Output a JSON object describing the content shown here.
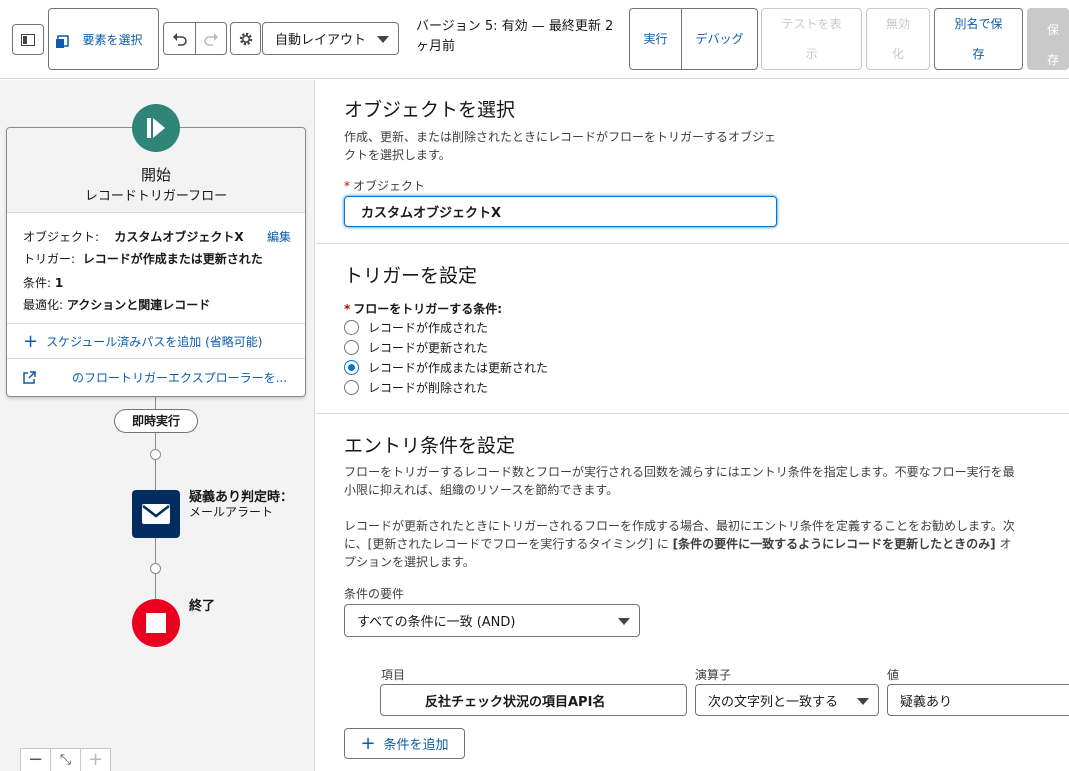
{
  "toolbar": {
    "select_element": "要素を選択",
    "layout_select": "自動レイアウト",
    "version_text": "バージョン 5: 有効 — 最終更新 2ヶ月前",
    "run": "実行",
    "debug": "デバッグ",
    "show_test": "テストを表示",
    "deactivate": "無効化",
    "save_as": "別名で保存",
    "save": "保存"
  },
  "canvas": {
    "start_title": "開始",
    "start_subtitle": "レコードトリガーフロー",
    "object_label": "オブジェクト:",
    "object_value": "カスタムオブジェクトX",
    "edit_link": "編集",
    "trigger_label": "トリガー:",
    "trigger_value": "レコードが作成または更新された",
    "condition_label": "条件:",
    "condition_value": "1",
    "optimize_label": "最適化:",
    "optimize_value": "アクションと関連レコード",
    "add_scheduled_path": "スケジュール済みパスを追加 (省略可能)",
    "explorer_link": "のフロートリガーエクスプローラーを...",
    "immediate_run": "即時実行",
    "mail_title": "疑義あり判定時：",
    "mail_subtitle": "メールアラート",
    "end_label": "終了",
    "zoom_out": "−",
    "zoom_fit": "⤡",
    "zoom_in": "+"
  },
  "panel": {
    "object_section": {
      "title": "オブジェクトを選択",
      "description_line1": "作成、更新、または削除されたときにレコードがフローをトリガーするオブジェ",
      "description_line2": "クトを選択します。",
      "field_label": "オブジェクト",
      "field_value": "カスタムオブジェクトX"
    },
    "trigger_section": {
      "title": "トリガーを設定",
      "field_label": "フローをトリガーする条件:",
      "options": [
        "レコードが作成された",
        "レコードが更新された",
        "レコードが作成または更新された",
        "レコードが削除された"
      ],
      "selected_index": 2
    },
    "entry_section": {
      "title": "エントリ条件を設定",
      "para1_line1": "フローをトリガーするレコード数とフローが実行される回数を減らすにはエントリ条件を指定します。不要なフロー実行を最",
      "para1_line2": "小限に抑えれば、組織のリソースを節約できます。",
      "para2_line1": "レコードが更新されたときにトリガーされるフローを作成する場合、最初にエントリ条件を定義することをお勧めします。次",
      "para2_line2_pre": "に、[更新されたレコードでフローを実行するタイミング] に ",
      "para2_line2_bold": "[条件の要件に一致するようにレコードを更新したときのみ]",
      "para2_line2_post": " オ",
      "para2_line3": "プションを選択します。",
      "requirement_label": "条件の要件",
      "requirement_value": "すべての条件に一致 (AND)",
      "col_field": "項目",
      "col_operator": "演算子",
      "col_value": "値",
      "row_field": "反社チェック状況の項目API名",
      "row_operator": "次の文字列と一致する",
      "row_value": "疑義あり",
      "add_condition": "条件を追加"
    }
  },
  "colors": {
    "brand_blue": "#0b5cab",
    "start_green": "#2e8577",
    "mail_navy": "#032d60",
    "end_red": "#ea001e"
  }
}
